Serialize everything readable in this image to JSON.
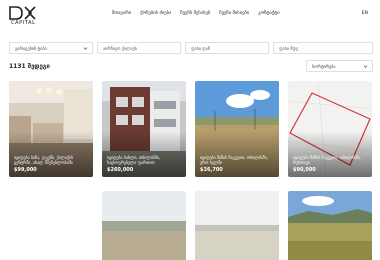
{
  "brand": {
    "logo_text": "CAPITAL"
  },
  "nav": {
    "items": [
      "მთავარი",
      "ქონების ძიება",
      "ჩვენს შესახებ",
      "ჩვენი მისიები",
      "კონტაქტი"
    ],
    "language": "EN"
  },
  "filters": {
    "property_type": "გარიგების ტიპი",
    "location_placeholder": "აირჩიეთ ქალაქი",
    "price_from_placeholder": "ფასი დან",
    "price_to_placeholder": "ფასი მდე"
  },
  "results": {
    "count_label": "1131 შედეგი",
    "sort_label": "სორტირება"
  },
  "listings": [
    {
      "title": "იყიდება ბინა, ვაკეში, ქალაქის ცენტრში, ახალ მშენებლობაში",
      "price": "$99,000"
    },
    {
      "title": "იყიდება სახლი, თბილისში, საცხოვრებელი ფართით",
      "price": "$260,000"
    },
    {
      "title": "იყიდება მიწის ნაკვეთი, თბილისში, ერთ ხელში",
      "price": "$36,700"
    },
    {
      "title": "იყიდება მიწის ნაკვეთი, თბილისში, რუსთავი",
      "price": "$90,000"
    }
  ],
  "colors": {
    "accent_red": "#d33a3a",
    "card_overlay": "#000000"
  }
}
